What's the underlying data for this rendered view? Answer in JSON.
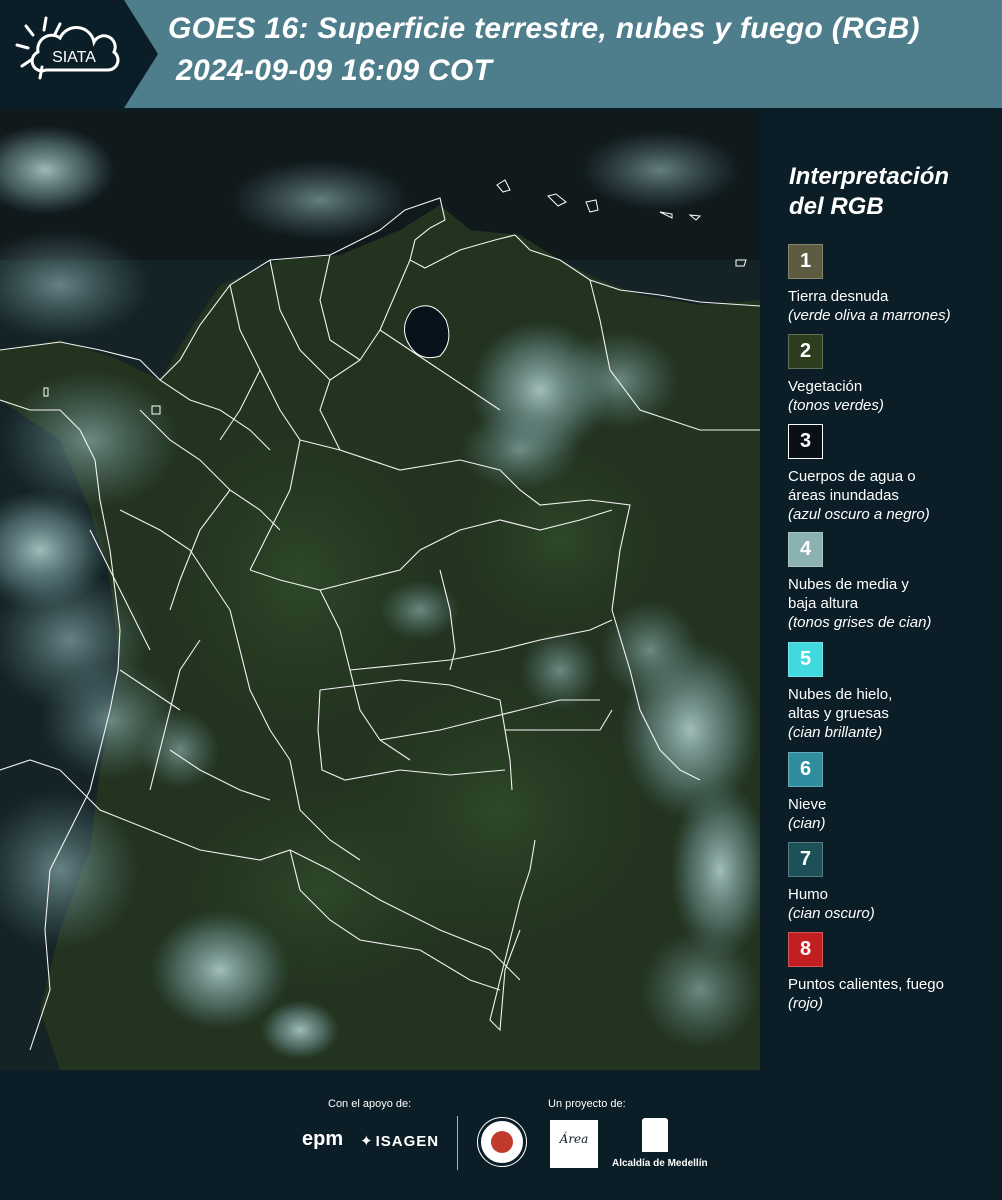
{
  "header": {
    "logo_text": "SIATA",
    "title_line1": "GOES 16: Superficie terrestre, nubes y fuego (RGB)",
    "title_line2": "2024-09-09 16:09 COT",
    "background_color": "#4e7d8c"
  },
  "legend": {
    "title": "Interpretación del RGB",
    "items": [
      {
        "number": "1",
        "label": "Tierra desnuda",
        "note": "(verde oliva a marrones)",
        "color": "#5e5c40"
      },
      {
        "number": "2",
        "label": "Vegetación",
        "note": "(tonos verdes)",
        "color": "#2c3e1e"
      },
      {
        "number": "3",
        "label": "Cuerpos de agua o",
        "label2": "áreas inundadas",
        "note": "(azul oscuro a negro)",
        "color": "#0a1018"
      },
      {
        "number": "4",
        "label": "Nubes de media y",
        "label2": "baja altura",
        "note": "(tonos grises de cian)",
        "color": "#8bb2b0"
      },
      {
        "number": "5",
        "label": "Nubes de hielo,",
        "label2": "altas y gruesas",
        "note": "(cian brillante)",
        "color": "#41d9df"
      },
      {
        "number": "6",
        "label": "Nieve",
        "note": "(cian)",
        "color": "#2f8d9f"
      },
      {
        "number": "7",
        "label": "Humo",
        "note": "(cian oscuro)",
        "color": "#1c5158"
      },
      {
        "number": "8",
        "label": "Puntos calientes, fuego",
        "note": "(rojo)",
        "color": "#c21f22"
      }
    ]
  },
  "footer": {
    "support_label": "Con el apoyo de:",
    "project_label": "Un proyecto de:",
    "epm": "epm",
    "isagen": "ISAGEN",
    "area_logo_text": "Área",
    "alcaldia": "Alcaldía de Medellín"
  }
}
